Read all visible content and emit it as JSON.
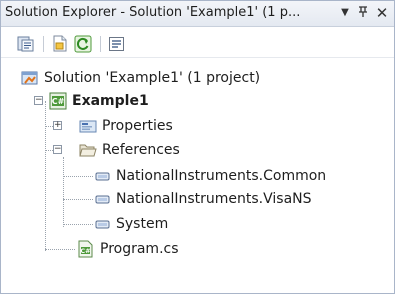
{
  "window": {
    "title": "Solution Explorer - Solution 'Example1' (1 p...",
    "dropdown_icon": "chevron-down-icon",
    "pin_icon": "pin-icon",
    "close_icon": "close-icon",
    "dropdown_glyph": "▼",
    "pin_glyph": "⊥",
    "close_glyph": "✕"
  },
  "toolbar": {
    "buttons": [
      {
        "name": "properties-button",
        "icon": "properties-icon"
      },
      {
        "name": "show-all-files-button",
        "icon": "show-all-files-icon"
      },
      {
        "name": "refresh-button",
        "icon": "refresh-icon"
      },
      {
        "name": "view-code-button",
        "icon": "view-code-icon"
      }
    ]
  },
  "tree": {
    "solution": {
      "label": "Solution 'Example1' (1 project)",
      "icon": "solution-icon"
    },
    "project": {
      "label": "Example1",
      "icon": "csharp-project-icon",
      "expanded": true
    },
    "properties": {
      "label": "Properties",
      "icon": "properties-folder-icon",
      "expanded": false
    },
    "references": {
      "label": "References",
      "icon": "folder-open-icon",
      "expanded": true
    },
    "reference_items": [
      {
        "label": "NationalInstruments.Common",
        "icon": "reference-icon"
      },
      {
        "label": "NationalInstruments.VisaNS",
        "icon": "reference-icon"
      },
      {
        "label": "System",
        "icon": "reference-icon"
      }
    ],
    "program": {
      "label": "Program.cs",
      "icon": "csharp-file-icon"
    },
    "expander_collapsed": "+",
    "expander_expanded": "−"
  }
}
